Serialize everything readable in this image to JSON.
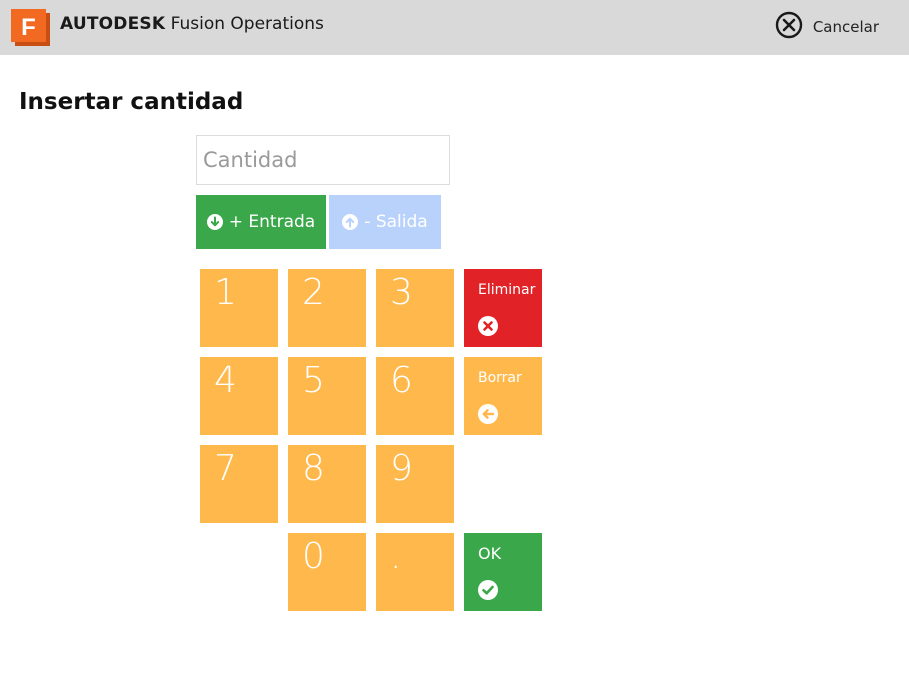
{
  "header": {
    "logo_letter": "F",
    "brand_bold": "AUTODESK",
    "brand_rest": "Fusion Operations",
    "cancel_label": "Cancelar",
    "cancel_icon": "close-circle-icon"
  },
  "title": "Insertar cantidad",
  "quantity_input": {
    "placeholder": "Cantidad",
    "value": ""
  },
  "direction": {
    "in_label": "+ Entrada",
    "in_icon": "arrow-down-circle-icon",
    "out_label": "- Salida",
    "out_icon": "arrow-up-circle-icon"
  },
  "keypad": {
    "digits": [
      "1",
      "2",
      "3",
      "4",
      "5",
      "6",
      "7",
      "8",
      "9",
      "0",
      "."
    ],
    "delete_label": "Eliminar",
    "delete_icon": "x-circle-icon",
    "backspace_label": "Borrar",
    "backspace_icon": "arrow-left-circle-icon",
    "ok_label": "OK",
    "ok_icon": "check-circle-icon"
  },
  "colors": {
    "topbar": "#d9d9d9",
    "key": "#ffb84b",
    "green": "#3aa84a",
    "red": "#e12227",
    "disabled_blue": "#b9d2fb",
    "logo_orange": "#f26a22"
  }
}
